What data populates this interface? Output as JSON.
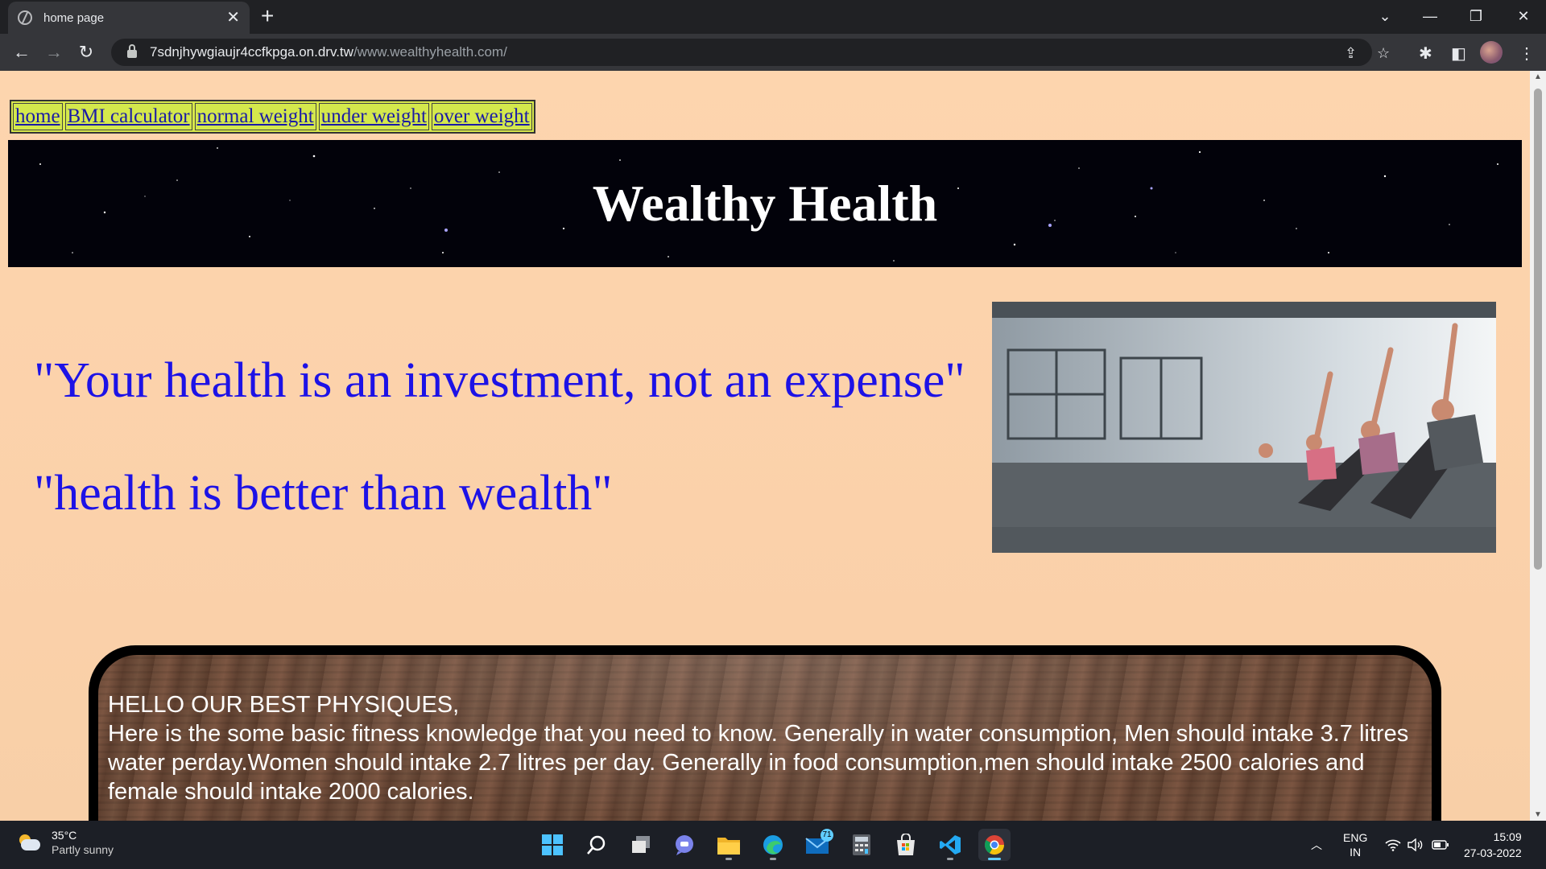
{
  "browser": {
    "tab_title": "home page",
    "tab_close": "✕",
    "new_tab": "+",
    "url_host": "7sdnjhywgiaujr4ccfkpga.on.drv.tw",
    "url_path": "/www.wealthyhealth.com/"
  },
  "site": {
    "nav": [
      "home",
      "BMI calculator",
      "normal weight",
      "under weight",
      "over weight"
    ],
    "banner_title": "Wealthy Health",
    "quote_1": "\"Your health is an investment, not an expense\"",
    "quote_2": "\"health is better than wealth\"",
    "info_heading": "HELLO OUR BEST PHYSIQUES,",
    "info_body": "Here is the some basic fitness knowledge that you need to know. Generally in water consumption, Men should intake 3.7 litres water perday.Women should intake 2.7 litres per day. Generally in food consumption,men should intake 2500 calories and female should intake 2000 calories."
  },
  "taskbar": {
    "weather_temp": "35°C",
    "weather_desc": "Partly sunny",
    "mail_badge": "71",
    "lang_1": "ENG",
    "lang_2": "IN",
    "time": "15:09",
    "date": "27-03-2022"
  },
  "colors": {
    "page_bg": "#fdd5ae",
    "nav_bg": "#d4e84c",
    "link": "#1a1aa6",
    "quote": "#1d12e6",
    "banner_bg": "#02020a"
  }
}
